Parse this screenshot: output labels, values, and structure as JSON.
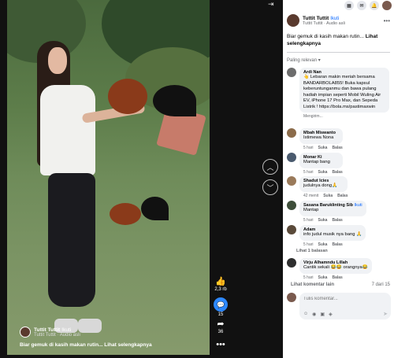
{
  "video": {
    "caption": "Biar gemuk di kasih makan rutin... Lihat selengkapnya",
    "author": "Tuttit Tuttit",
    "follow": "Ikuti",
    "audio": "Tuttit Tuttit · Audio asli"
  },
  "actions": {
    "likes": "2,3 rb",
    "comments": "15",
    "shares": "36",
    "more": "•••"
  },
  "icons": {
    "like": "thumbs-up-icon",
    "comment": "comment-icon",
    "share": "share-icon",
    "up": "chevron-up-icon",
    "down": "chevron-down-icon"
  },
  "topbar": {
    "icons": [
      "grid-icon",
      "messenger-icon",
      "bell-icon",
      "profile-avatar"
    ]
  },
  "post": {
    "name": "Tuttit Tuttit",
    "follow": "Ikuti",
    "sub": "Tuttit Tuttit · Audio asli",
    "menu": "•••",
    "text": "Biar gemuk di kasih makan rutin...",
    "more": "Lihat selengkapnya"
  },
  "sort": {
    "label": "Paling relevan ▾"
  },
  "comments": [
    {
      "name": "Ardi Nan",
      "follow": "",
      "text": "👆 Lebaran makin meriah bersama BANDARBOLA855! Buka kapsul keberuntunganmu dan bawa pulang hadiah impian seperti Mobil Wuling Air EV, iPhone 17 Pro Max, dan Sepeda Listrik ! https://bola.ms/pastimaxwin",
      "time": "Mengirim...",
      "like": "",
      "reply": "",
      "avatar_color": "#6c6c6c"
    },
    {
      "name": "Mbah Miswanto",
      "follow": "",
      "text": "Istimewa Nona",
      "time": "5 hari",
      "like": "Suka",
      "reply": "Balas",
      "avatar_color": "#8b6b4a"
    },
    {
      "name": "Monar Ki",
      "follow": "",
      "text": "Mantap bang",
      "time": "5 hari",
      "like": "Suka",
      "reply": "Balas",
      "avatar_color": "#4a5a6e"
    },
    {
      "name": "Shadut Icies",
      "follow": "",
      "text": "judulnya dong🙏",
      "time": "42 menit",
      "like": "Suka",
      "reply": "Balas",
      "avatar_color": "#9a7a5a"
    },
    {
      "name": "Sasana Baruklinting Sib",
      "follow": "Ikuti",
      "text": "Mantap",
      "time": "5 hari",
      "like": "Suka",
      "reply": "Balas",
      "avatar_color": "#3e4e3a"
    },
    {
      "name": "Adam",
      "follow": "",
      "text": "info judul musik nya bang 🙏",
      "time": "5 hari",
      "like": "Suka",
      "reply": "Balas",
      "avatar_color": "#5a4a3a"
    },
    {
      "name": "Virju Alhamndu Lillah",
      "follow": "",
      "text": "Cantik sekali 😂😂 orangnya😂",
      "time": "5 hari",
      "like": "Suka",
      "reply": "Balas",
      "avatar_color": "#2e2e2e"
    }
  ],
  "reply_link": "Lihat 1 balasan",
  "more_comments": {
    "label": "Lihat komentar lain",
    "count": "7 dari 15"
  },
  "compose": {
    "placeholder": "Tulis komentar...",
    "icons": [
      "avatar-icon",
      "emoji-icon",
      "camera-icon",
      "gif-icon",
      "sticker-icon"
    ]
  }
}
